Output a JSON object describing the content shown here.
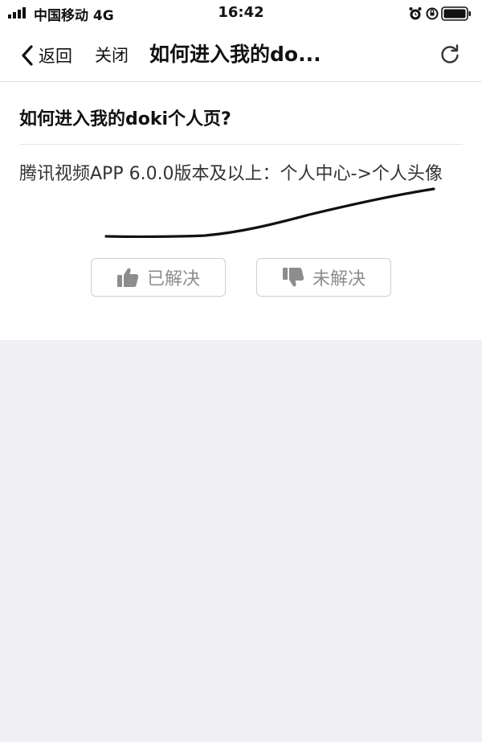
{
  "status_bar": {
    "carrier": "中国移动 4G",
    "time": "16:42",
    "icons": [
      "signal-icon",
      "alarm-icon",
      "orientation-lock-icon",
      "battery-icon"
    ]
  },
  "nav": {
    "back_label": "返回",
    "close_label": "关闭",
    "title": "如何进入我的do...",
    "icons": [
      "chevron-left-icon",
      "refresh-icon"
    ]
  },
  "question": {
    "title": "如何进入我的doki个人页?",
    "answer": "腾讯视频APP 6.0.0版本及以上：个人中心->个人头像"
  },
  "feedback": {
    "resolved_label": "已解决",
    "unresolved_label": "未解决",
    "icons": [
      "thumbs-up-icon",
      "thumbs-down-icon"
    ]
  },
  "colors": {
    "page_background": "#efeff4",
    "panel_background": "#ffffff",
    "muted_text": "#8d8d8d",
    "border": "#cfcfcf"
  }
}
